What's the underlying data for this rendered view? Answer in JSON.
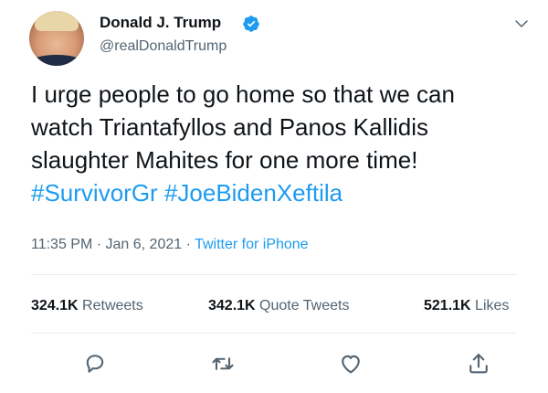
{
  "author": {
    "display_name": "Donald J. Trump",
    "handle": "@realDonaldTrump",
    "verified": true
  },
  "tweet": {
    "lines": [
      "I urge people to go home so that we can",
      "watch Triantafyllos and Panos Kallidis",
      "slaughter Mahites for one more time!"
    ],
    "hashtags": [
      "#SurvivorGr",
      "#JoeBidenXeftila"
    ]
  },
  "meta": {
    "time": "11:35 PM",
    "separator": " · ",
    "date": "Jan 6, 2021",
    "source": "Twitter for iPhone"
  },
  "stats": {
    "retweets": {
      "count": "324.1K",
      "label": "Retweets"
    },
    "quote_tweets": {
      "count": "342.1K",
      "label": "Quote Tweets"
    },
    "likes": {
      "count": "521.1K",
      "label": "Likes"
    }
  },
  "icons": {
    "verified": "verified-badge-icon",
    "caret": "chevron-down-icon",
    "reply": "reply-icon",
    "retweet": "retweet-icon",
    "like": "heart-icon",
    "share": "share-icon"
  },
  "colors": {
    "accent": "#1d9bf0",
    "text": "#0f1419",
    "secondary": "#536471",
    "divider": "#e6ecf0"
  }
}
